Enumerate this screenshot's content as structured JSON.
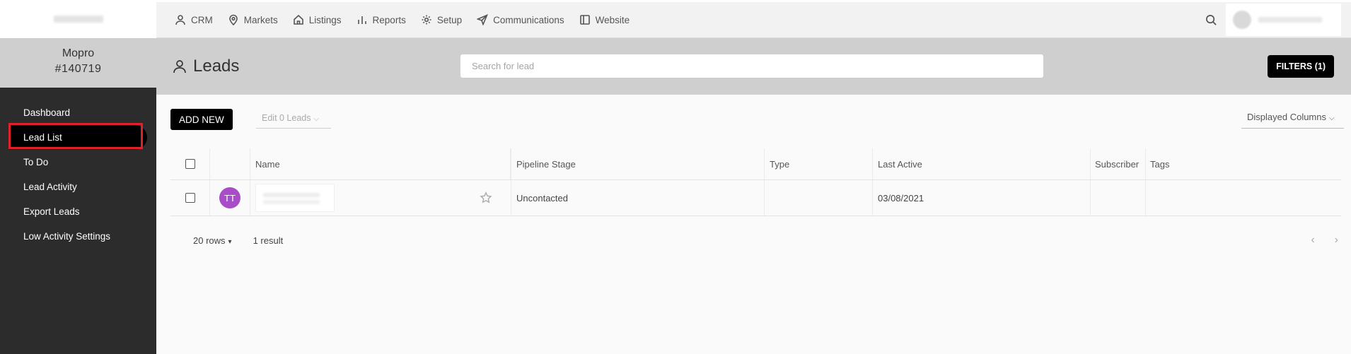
{
  "sidebar": {
    "account_name": "Mopro",
    "account_id": "#140719",
    "items": [
      {
        "label": "Dashboard"
      },
      {
        "label": "Lead List"
      },
      {
        "label": "To Do"
      },
      {
        "label": "Lead Activity"
      },
      {
        "label": "Export Leads"
      },
      {
        "label": "Low Activity Settings"
      }
    ],
    "active_item": "Lead List"
  },
  "topnav": {
    "items": [
      {
        "label": "CRM",
        "icon": "user-icon"
      },
      {
        "label": "Markets",
        "icon": "map-pin-icon"
      },
      {
        "label": "Listings",
        "icon": "home-icon"
      },
      {
        "label": "Reports",
        "icon": "bar-chart-icon"
      },
      {
        "label": "Setup",
        "icon": "gear-icon"
      },
      {
        "label": "Communications",
        "icon": "send-icon"
      },
      {
        "label": "Website",
        "icon": "window-icon"
      }
    ]
  },
  "page": {
    "title": "Leads",
    "search_placeholder": "Search for lead",
    "filters_label": "FILTERS (1)"
  },
  "toolbar": {
    "add_new_label": "ADD NEW",
    "edit_label": "Edit 0 Leads",
    "displayed_columns_label": "Displayed Columns"
  },
  "table": {
    "headers": {
      "name": "Name",
      "pipeline": "Pipeline Stage",
      "type": "Type",
      "last_active": "Last Active",
      "subscriber": "Subscriber",
      "tags": "Tags"
    },
    "rows": [
      {
        "initials": "TT",
        "pipeline": "Uncontacted",
        "type": "",
        "last_active": "03/08/2021",
        "subscriber": "",
        "tags": ""
      }
    ]
  },
  "footer": {
    "rows_label": "20 rows",
    "result_count": "1 result",
    "prev": "‹",
    "next": "›"
  },
  "colors": {
    "sidebar_bg": "#2c2c2c",
    "header_band": "#cfcfcf",
    "avatar": "#a94cc8",
    "highlight": "#e0202a"
  }
}
